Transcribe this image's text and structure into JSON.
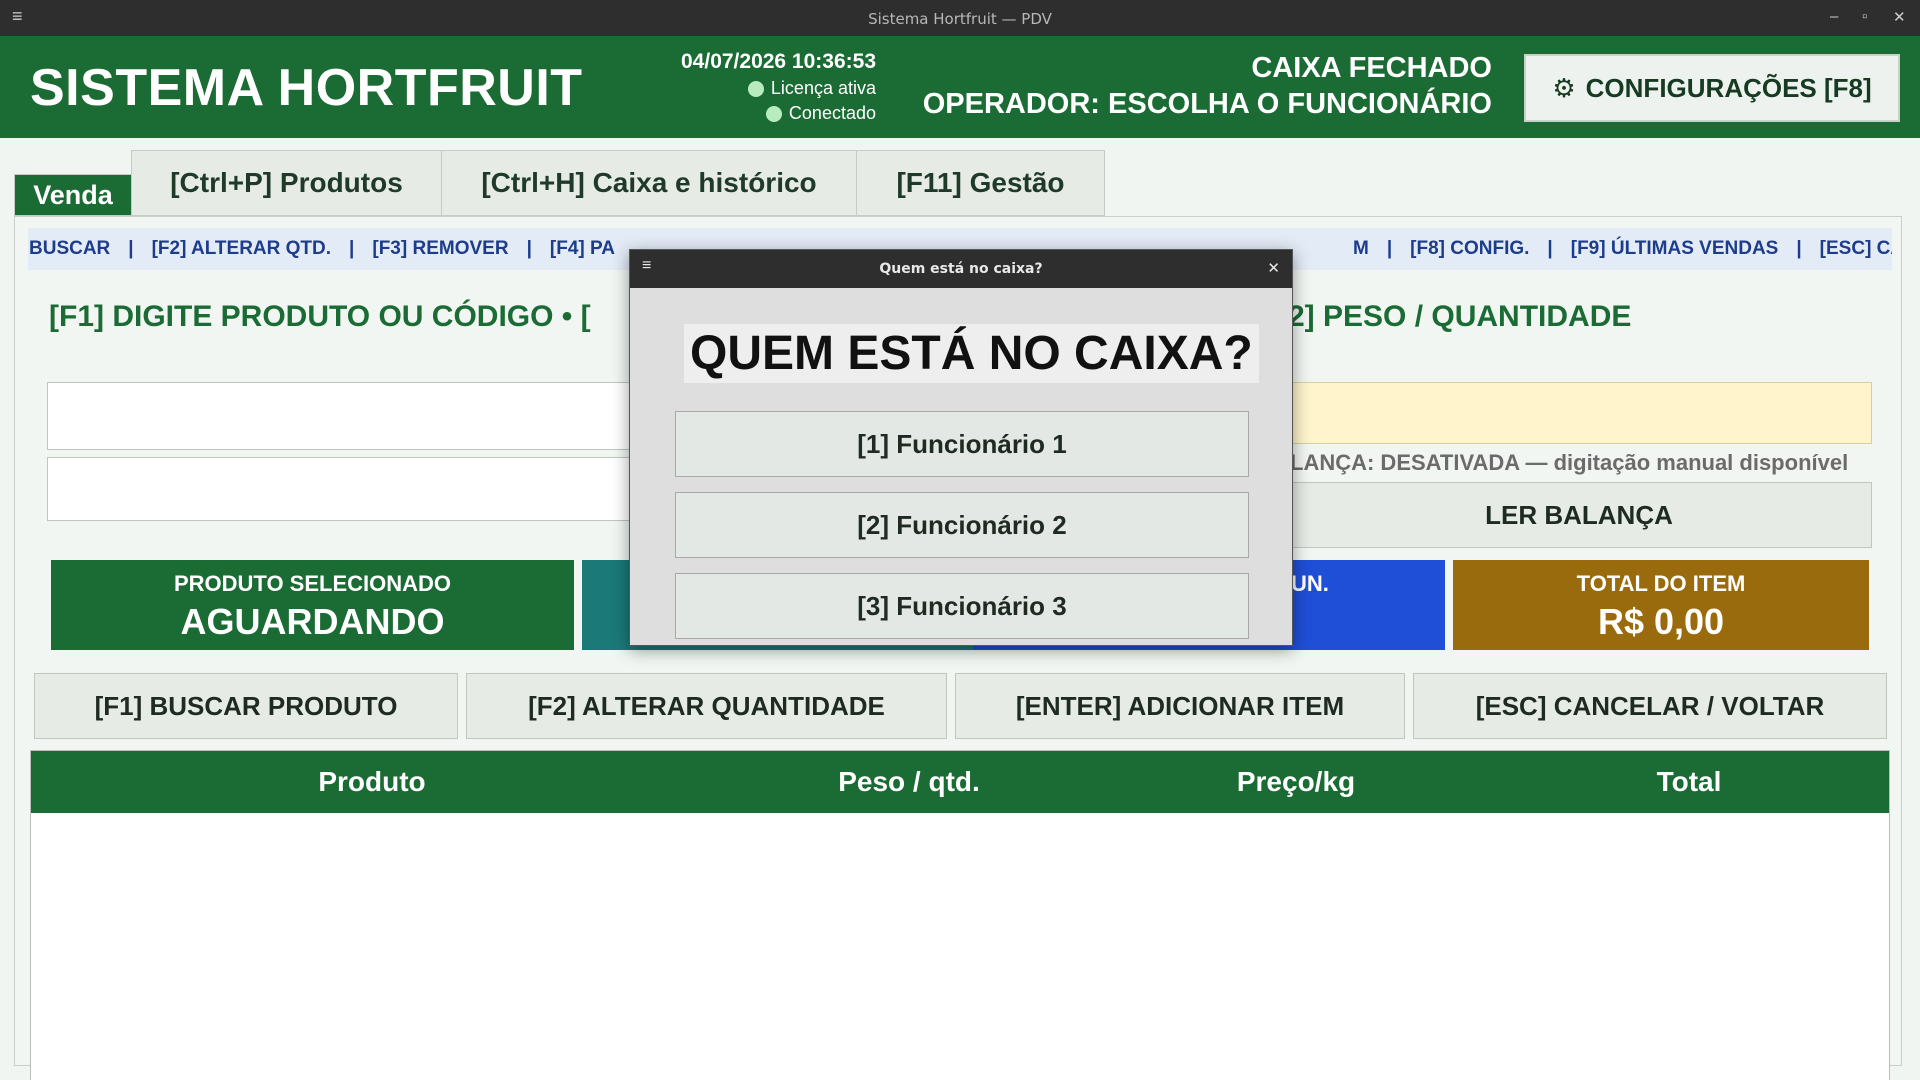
{
  "window": {
    "title": "Sistema Hortfruit — PDV",
    "menu_icon": "≡",
    "minimize": "‒",
    "maximize": "▫",
    "close": "✕"
  },
  "header": {
    "app_title": "SISTEMA HORTFRUIT",
    "datetime": "04/07/2026 10:36:53",
    "license": "Licença ativa",
    "connection": "Conectado",
    "cash_status": "CAIXA FECHADO",
    "operator": "OPERADOR: ESCOLHA O FUNCIONÁRIO",
    "config_icon": "⚙",
    "config_label": "CONFIGURAÇÕES  [F8]"
  },
  "tabs": [
    {
      "label": "Venda",
      "active": true
    },
    {
      "label": "[Ctrl+P] Produtos",
      "active": false
    },
    {
      "label": "[Ctrl+H] Caixa e histórico",
      "active": false
    },
    {
      "label": "[F11] Gestão",
      "active": false
    }
  ],
  "shortcut_bar": [
    "BUSCAR",
    "[F2] ALTERAR QTD.",
    "[F3] REMOVER",
    "[F4] PA",
    "M",
    "[F8] CONFIG.",
    "[F9] ÚLTIMAS VENDAS",
    "[ESC] CANCI"
  ],
  "entry": {
    "product_label": "[F1] DIGITE PRODUTO OU CÓDIGO  •  [",
    "weight_label": "2] PESO / QUANTIDADE",
    "balance_note": "LANÇA: DESATIVADA — digitação manual disponível",
    "read_scale": "LER BALANÇA"
  },
  "cards": {
    "selected_label": "PRODUTO SELECIONADO",
    "selected_value": "AGUARDANDO",
    "unit_label": "UN.",
    "total_label": "TOTAL DO ITEM",
    "total_value": "R$ 0,00"
  },
  "actions": [
    "[F1] BUSCAR PRODUTO",
    "[F2] ALTERAR QUANTIDADE",
    "[ENTER] ADICIONAR ITEM",
    "[ESC] CANCELAR / VOLTAR"
  ],
  "table": {
    "columns": [
      "Produto",
      "Peso / qtd.",
      "Preço/kg",
      "Total"
    ]
  },
  "modal": {
    "title": "Quem está no caixa?",
    "heading": "QUEM ESTÁ NO CAIXA?",
    "menu_icon": "≡",
    "close_icon": "✕",
    "employees": [
      "[1] Funcionário 1",
      "[2] Funcionário 2",
      "[3] Funcionário 3"
    ]
  },
  "colors": {
    "primary_green": "#1b6b35",
    "teal": "#1b7a78",
    "blue": "#1f4fd6",
    "amber": "#9a6b0c"
  }
}
